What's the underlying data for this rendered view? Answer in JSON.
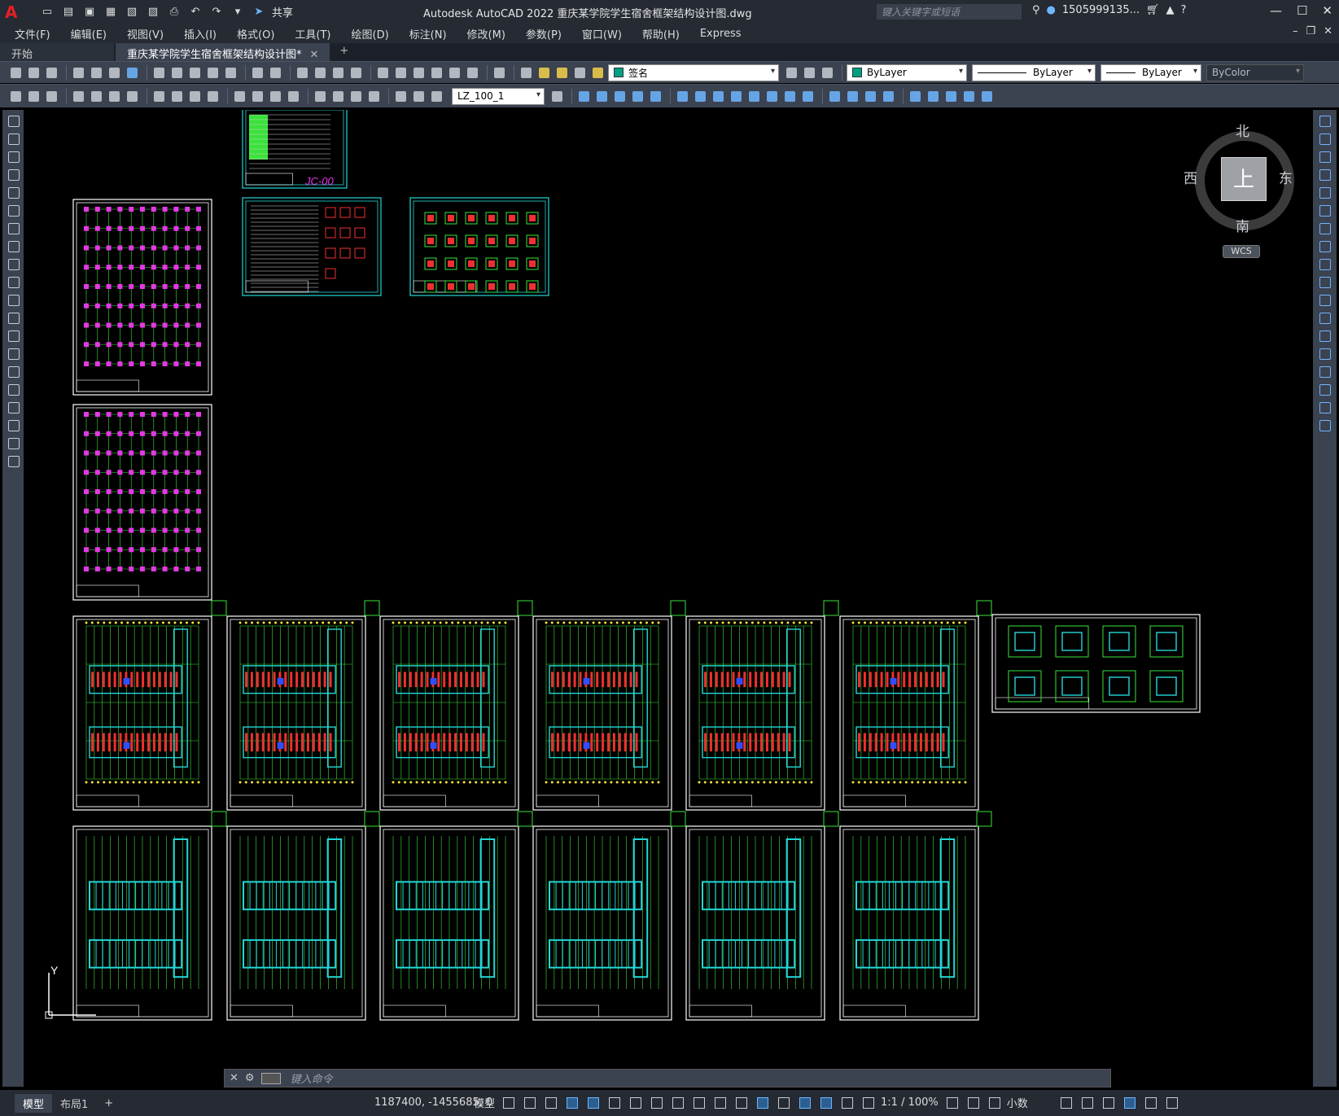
{
  "app": {
    "logo": "A",
    "title": "Autodesk AutoCAD 2022    重庆某学院学生宿舍框架结构设计图.dwg",
    "share_label": "共享",
    "search_placeholder": "键入关键字或短语",
    "user": "1505999135...",
    "help": "?"
  },
  "menu": [
    "文件(F)",
    "编辑(E)",
    "视图(V)",
    "插入(I)",
    "格式(O)",
    "工具(T)",
    "绘图(D)",
    "标注(N)",
    "修改(M)",
    "参数(P)",
    "窗口(W)",
    "帮助(H)",
    "Express"
  ],
  "tabs": {
    "start": "开始",
    "active": "重庆某学院学生宿舍框架结构设计图*",
    "plus": "+"
  },
  "toolbar": {
    "layer": "签名",
    "color": "ByLayer",
    "linetype": "ByLayer",
    "lineweight": "ByLayer",
    "plotstyle": "ByColor",
    "dimstyle": "LZ_100_1"
  },
  "viewcube": {
    "north": "北",
    "south": "南",
    "east": "东",
    "west": "西",
    "face": "上",
    "wcs": "WCS"
  },
  "ucs": {
    "y": "Y"
  },
  "sheets": {
    "jc00": "JC-00"
  },
  "command": {
    "placeholder": "键入命令"
  },
  "status": {
    "model_tab": "模型",
    "layout_tab": "布局1",
    "add_layout": "+",
    "coords": "1187400, -1455685, 0",
    "model_label": "模型",
    "scale": "1:1 / 100%",
    "units": "小数"
  },
  "colors": {
    "background": "#000000",
    "frame": "#ffffff",
    "cyan": "#24d7d7",
    "green": "#39e339",
    "magenta": "#e637e6",
    "yellow": "#f5e33a",
    "red": "#ef2f2f",
    "blue": "#2f4fff"
  }
}
